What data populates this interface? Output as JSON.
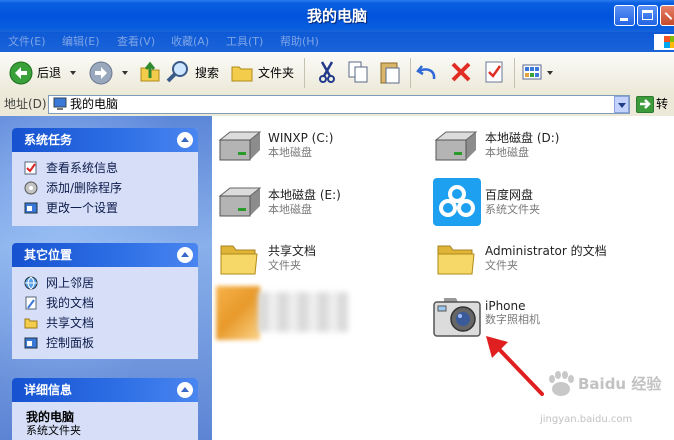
{
  "window": {
    "title": "我的电脑"
  },
  "menu": [
    "文件(E)",
    "编辑(E)",
    "查看(V)",
    "收藏(A)",
    "工具(T)",
    "帮助(H)"
  ],
  "toolbar": {
    "back_label": "后退",
    "search_label": "搜索",
    "folders_label": "文件夹"
  },
  "address": {
    "label": "地址(D)",
    "value": "我的电脑",
    "go_label": "转"
  },
  "sidebar": {
    "system_tasks": {
      "title": "系统任务",
      "items": [
        "查看系统信息",
        "添加/删除程序",
        "更改一个设置"
      ]
    },
    "other_places": {
      "title": "其它位置",
      "items": [
        "网上邻居",
        "我的文档",
        "共享文档",
        "控制面板"
      ]
    },
    "details": {
      "title": "详细信息",
      "name": "我的电脑",
      "type": "系统文件夹"
    }
  },
  "items": [
    {
      "name": "WINXP (C:)",
      "type": "本地磁盘",
      "icon": "hard-drive-icon"
    },
    {
      "name": "本地磁盘 (D:)",
      "type": "本地磁盘",
      "icon": "hard-drive-icon"
    },
    {
      "name": "本地磁盘 (E:)",
      "type": "本地磁盘",
      "icon": "hard-drive-icon"
    },
    {
      "name": "百度网盘",
      "type": "系统文件夹",
      "icon": "baidu-cloud-icon"
    },
    {
      "name": "共享文档",
      "type": "文件夹",
      "icon": "folder-icon"
    },
    {
      "name": "Administrator 的文档",
      "type": "文件夹",
      "icon": "folder-icon"
    },
    {
      "name": "iPhone",
      "type": "数字照相机",
      "icon": "camera-icon"
    }
  ],
  "watermark": {
    "text": "Baidu 经验",
    "url": "jingyan.baidu.com"
  },
  "colors": {
    "title_bar": "#0053db",
    "task_pane": "#d6dff7",
    "panel_header": "#1652d0",
    "arrow": "#e02020"
  }
}
